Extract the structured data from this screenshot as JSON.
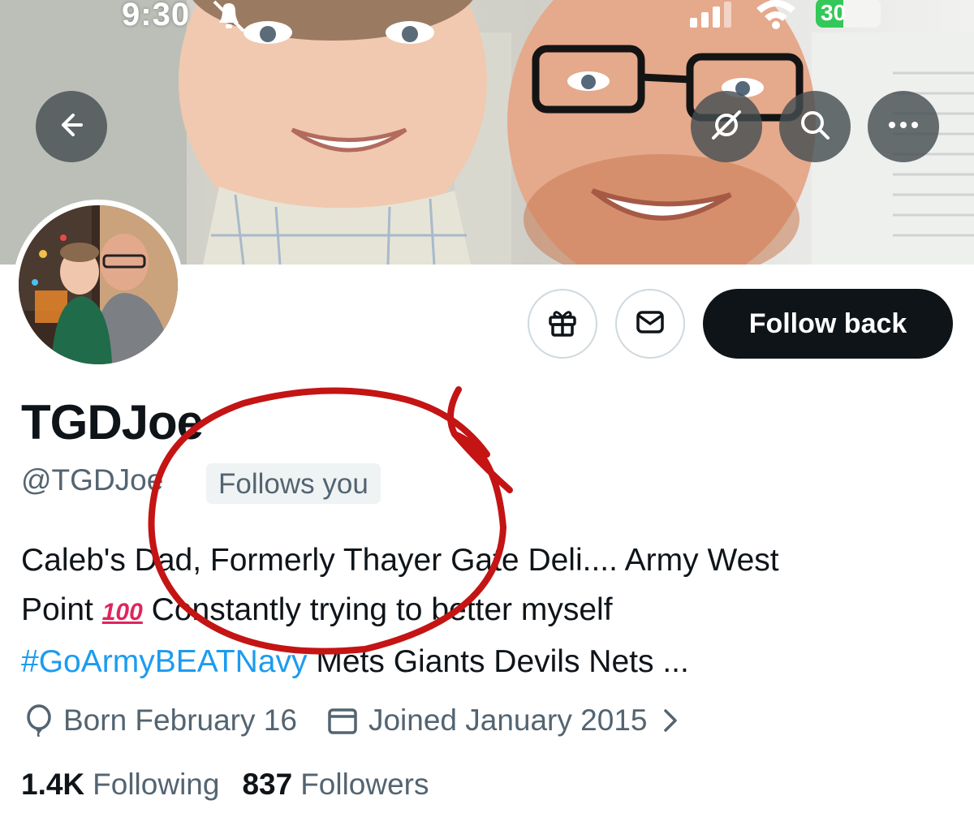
{
  "status_bar": {
    "time": "9:30",
    "battery": "30"
  },
  "header_icons": {
    "back": "arrow-left-icon",
    "grok": "grok-icon",
    "search": "search-icon",
    "more": "more-icon"
  },
  "actions": {
    "gift_icon": "gift-icon",
    "message_icon": "message-icon",
    "follow_label": "Follow back"
  },
  "profile": {
    "display_name": "TGDJoe",
    "handle": "@TGDJoe",
    "follows_you": "Follows you",
    "bio_line1": "Caleb's Dad, Formerly Thayer Gate Deli.... Army West",
    "bio_line2_a": "Point",
    "bio_emoji": "100",
    "bio_line2_b": "Constantly trying to better myself",
    "bio_hashtag": "#GoArmyBEATNavy",
    "bio_line3_rest": "Mets Giants Devils Nets ...",
    "born": "Born February 16",
    "joined": "Joined January 2015",
    "following_count": "1.4K",
    "following_label": "Following",
    "followers_count": "837",
    "followers_label": "Followers"
  },
  "colors": {
    "accent": "#1d9bf0",
    "follow_button_bg": "#0f1419",
    "secondary_text": "#536471",
    "annotation": "#c41414"
  }
}
